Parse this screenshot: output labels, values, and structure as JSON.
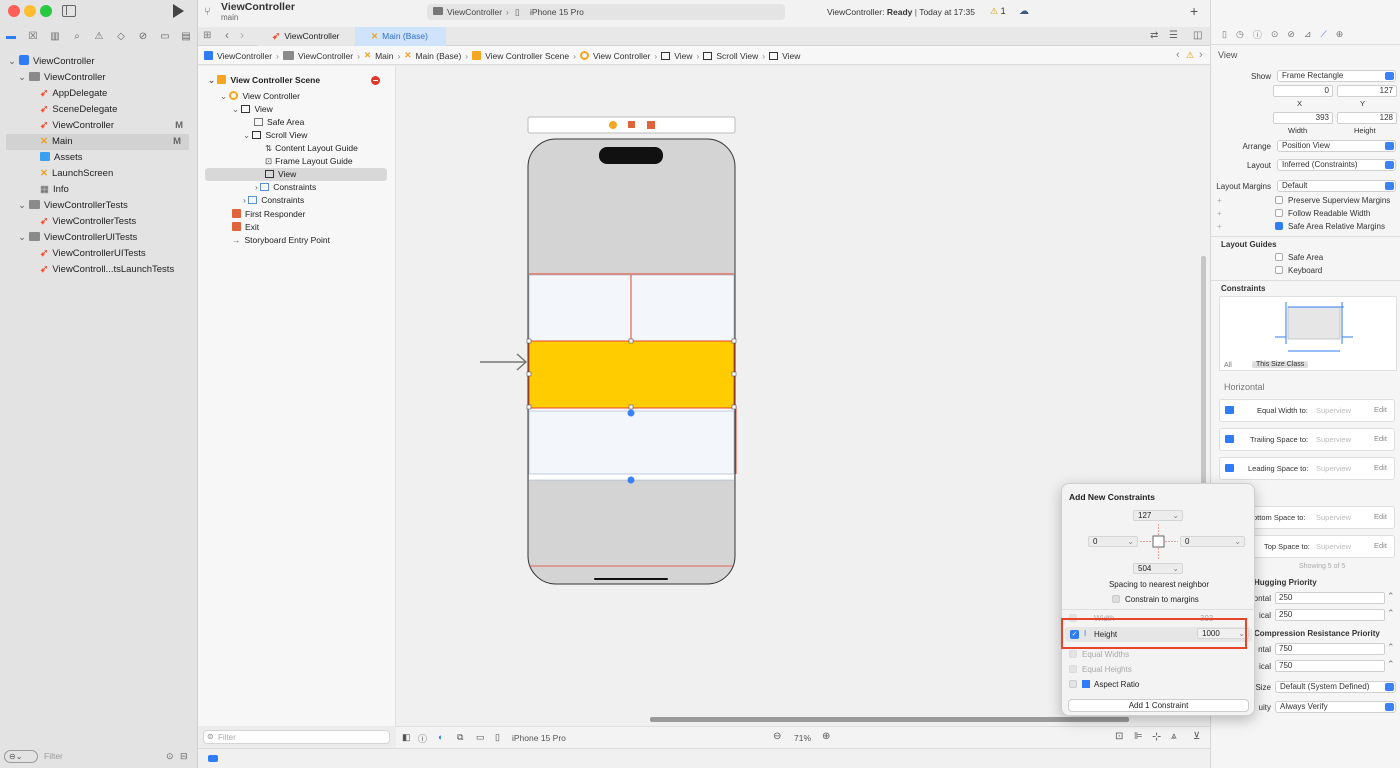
{
  "project": {
    "title": "ViewController",
    "branch": "main"
  },
  "scheme": {
    "target": "ViewController",
    "device": "iPhone 15 Pro",
    "status_prefix": "ViewController:",
    "status_state": "Ready",
    "status_time": "Today at 17:35",
    "warnings": "1"
  },
  "navigator": {
    "items": [
      {
        "label": "ViewController",
        "kind": "project",
        "level": 0,
        "marker": ""
      },
      {
        "label": "ViewController",
        "kind": "folder",
        "level": 1,
        "marker": ""
      },
      {
        "label": "AppDelegate",
        "kind": "swift",
        "level": 2,
        "marker": ""
      },
      {
        "label": "SceneDelegate",
        "kind": "swift",
        "level": 2,
        "marker": ""
      },
      {
        "label": "ViewController",
        "kind": "swift",
        "level": 2,
        "marker": "M"
      },
      {
        "label": "Main",
        "kind": "storyboard",
        "level": 2,
        "marker": "M"
      },
      {
        "label": "Assets",
        "kind": "assets",
        "level": 2,
        "marker": ""
      },
      {
        "label": "LaunchScreen",
        "kind": "storyboard",
        "level": 2,
        "marker": ""
      },
      {
        "label": "Info",
        "kind": "plist",
        "level": 2,
        "marker": ""
      },
      {
        "label": "ViewControllerTests",
        "kind": "folder",
        "level": 1,
        "marker": ""
      },
      {
        "label": "ViewControllerTests",
        "kind": "swift",
        "level": 2,
        "marker": ""
      },
      {
        "label": "ViewControllerUITests",
        "kind": "folder",
        "level": 1,
        "marker": ""
      },
      {
        "label": "ViewControllerUITests",
        "kind": "swift",
        "level": 2,
        "marker": ""
      },
      {
        "label": "ViewControll...tsLaunchTests",
        "kind": "swift",
        "level": 2,
        "marker": ""
      }
    ],
    "filter_placeholder": "Filter"
  },
  "tabs": [
    {
      "label": "ViewController"
    },
    {
      "label": "Main (Base)"
    }
  ],
  "jumpbar": [
    "ViewController",
    "ViewController",
    "Main",
    "Main (Base)",
    "View Controller Scene",
    "View Controller",
    "View",
    "Scroll View",
    "View"
  ],
  "outline": {
    "items": [
      {
        "label": "View Controller Scene"
      },
      {
        "label": "View Controller"
      },
      {
        "label": "View"
      },
      {
        "label": "Safe Area"
      },
      {
        "label": "Scroll View"
      },
      {
        "label": "Content Layout Guide"
      },
      {
        "label": "Frame Layout Guide"
      },
      {
        "label": "View"
      },
      {
        "label": "Constraints"
      },
      {
        "label": "Constraints"
      },
      {
        "label": "First Responder"
      },
      {
        "label": "Exit"
      },
      {
        "label": "Storyboard Entry Point"
      }
    ],
    "filter_placeholder": "Filter"
  },
  "canvas_bottom": {
    "device": "iPhone 15 Pro",
    "zoom": "71%"
  },
  "popover": {
    "title": "Add New Constraints",
    "top": "127",
    "left": "0",
    "right": "0",
    "bottom": "504",
    "spacing_label": "Spacing to nearest neighbor",
    "margins_label": "Constrain to margins",
    "width_label": "Width",
    "width_value": "393",
    "height_label": "Height",
    "height_value": "1000",
    "equal_widths": "Equal Widths",
    "equal_heights": "Equal Heights",
    "aspect_ratio": "Aspect Ratio",
    "add_button": "Add 1 Constraint"
  },
  "inspector": {
    "section": "View",
    "show_label": "Show",
    "show_value": "Frame Rectangle",
    "x": "0",
    "y": "127",
    "x_label": "X",
    "y_label": "Y",
    "width": "393",
    "height": "128",
    "width_label": "Width",
    "height_label": "Height",
    "arrange_label": "Arrange",
    "arrange_value": "Position View",
    "layout_label": "Layout",
    "layout_value": "Inferred (Constraints)",
    "margins_label": "Layout Margins",
    "margins_value": "Default",
    "preserve": "Preserve Superview Margins",
    "follow": "Follow Readable Width",
    "safe_rel": "Safe Area Relative Margins",
    "guides_title": "Layout Guides",
    "safe_area": "Safe Area",
    "keyboard": "Keyboard",
    "constraints_title": "Constraints",
    "all": "All",
    "size_class": "This Size Class",
    "horizontal": "Horizontal",
    "c1": "Equal Width to:",
    "c2": "Trailing Space to:",
    "c3": "Leading Space to:",
    "c4": "Bottom Space to:",
    "c5": "Top Space to:",
    "superview": "Superview",
    "edit": "Edit",
    "showing": "Showing 5 of 5",
    "hugging_title": "Hugging Priority",
    "h1_label": "ontal",
    "h1": "250",
    "h2_label": "ical",
    "h2": "250",
    "compression_title": "Compression Resistance Priority",
    "r1_label": "ntal",
    "r1": "750",
    "r2_label": "ical",
    "r2": "750",
    "size_label": "Size",
    "size_value": "Default (System Defined)",
    "ambiguity_label": "uity",
    "ambiguity_value": "Always Verify"
  },
  "colors": {
    "accent": "#2f7cf6",
    "highlight": "#ffcc00",
    "annotation": "#e8442a"
  }
}
